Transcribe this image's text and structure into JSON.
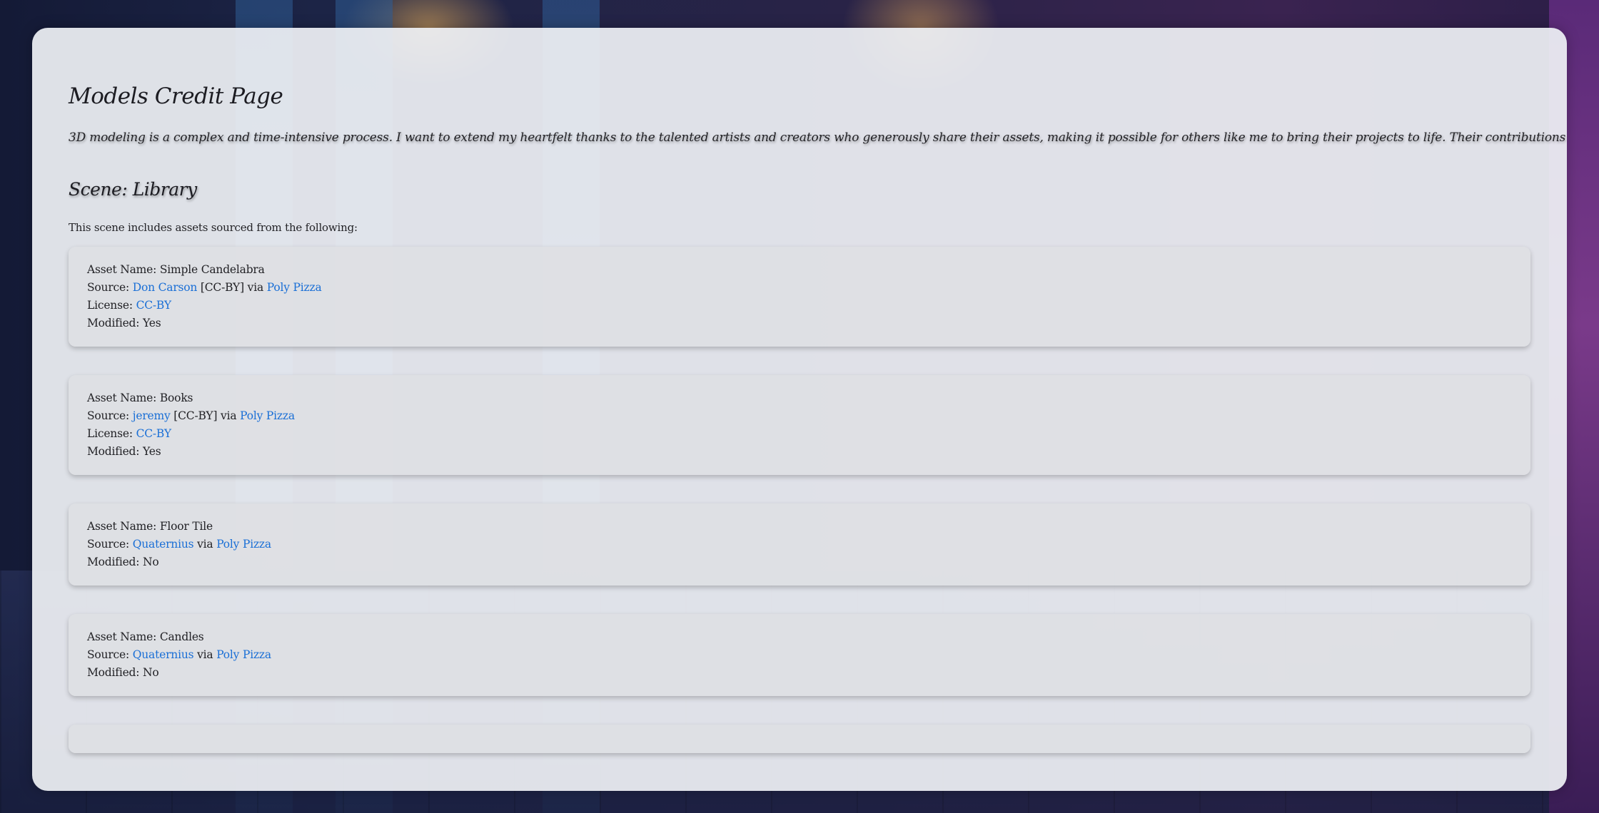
{
  "page": {
    "title": "Models Credit Page",
    "intro": "3D modeling is a complex and time-intensive process. I want to extend my heartfelt thanks to the talented artists and creators who generously share their assets, making it possible for others like me to bring their projects to life. Their contributions are invaluable and deeply appreciated."
  },
  "scene": {
    "title": "Scene: Library",
    "description": "This scene includes assets sourced from the following:"
  },
  "labels": {
    "asset_name": "Asset Name: ",
    "source": "Source: ",
    "license": "License: ",
    "modified": "Modified: ",
    "via": " via "
  },
  "assets": [
    {
      "name": "Simple Candelabra",
      "author": "Don Carson",
      "author_suffix": " [CC-BY]",
      "platform": "Poly Pizza",
      "license": "CC-BY",
      "modified": "Yes"
    },
    {
      "name": "Books",
      "author": "jeremy",
      "author_suffix": " [CC-BY]",
      "platform": "Poly Pizza",
      "license": "CC-BY",
      "modified": "Yes"
    },
    {
      "name": "Floor Tile",
      "author": "Quaternius",
      "author_suffix": "",
      "platform": "Poly Pizza",
      "modified": "No"
    },
    {
      "name": "Candles",
      "author": "Quaternius",
      "author_suffix": "",
      "platform": "Poly Pizza",
      "modified": "No"
    }
  ],
  "colors": {
    "link": "#1a6fd6",
    "panel_bg": "#eef0f4",
    "card_bg": "#dedfe3",
    "text": "#222226"
  }
}
